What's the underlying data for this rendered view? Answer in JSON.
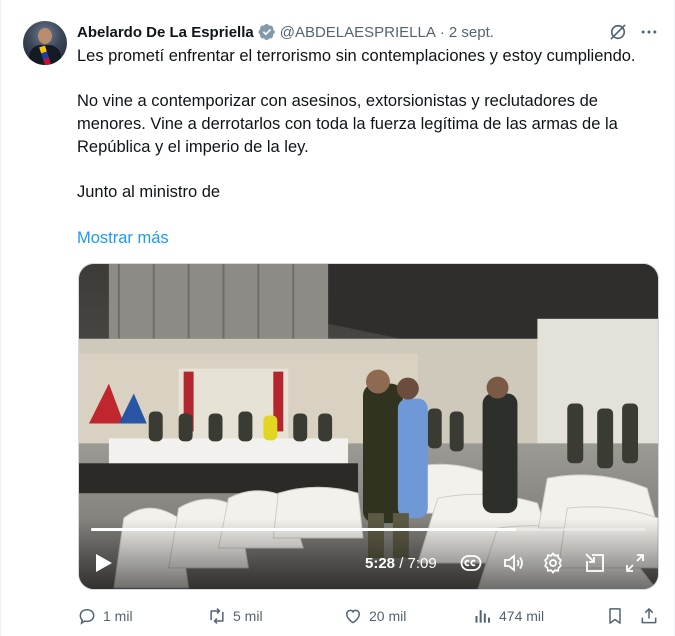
{
  "post": {
    "author_name": "Abelardo De La Espriella",
    "handle": "@ABDELAESPRIELLA",
    "separator": "·",
    "date": "2 sept.",
    "paragraphs": [
      "Les prometí enfrentar el terrorismo sin contemplaciones y estoy cumpliendo.",
      "No vine a contemporizar con asesinos, extorsionistas y reclutadores de menores. Vine a derrotarlos con toda la fuerza legítima de las armas de la República y el imperio de la ley.",
      "Junto al ministro de"
    ],
    "show_more": "Mostrar más"
  },
  "icons": {
    "verified": "verified-badge-icon",
    "grok": "grok-icon",
    "more": "more-icon"
  },
  "video": {
    "current_time": "5:28",
    "duration": "7:09",
    "progress": 0.765,
    "controls": [
      "play-icon",
      "captions-icon",
      "volume-icon",
      "settings-icon",
      "pip-icon",
      "fullscreen-icon"
    ]
  },
  "actions": {
    "replies": "1 mil",
    "reposts": "5 mil",
    "likes": "20 mil",
    "views": "474 mil"
  },
  "colors": {
    "accent": "#1d9bf0",
    "verified": "#829aab",
    "secondary_text": "#536471"
  }
}
